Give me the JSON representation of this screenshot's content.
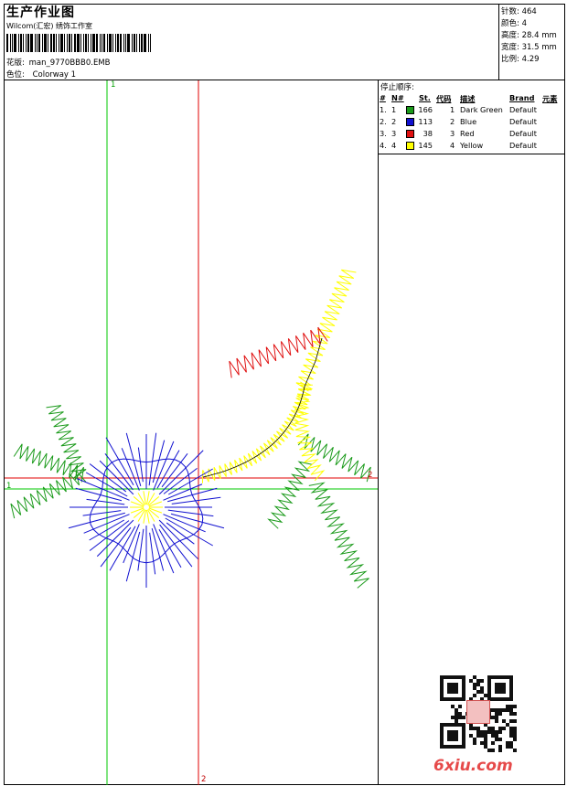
{
  "header": {
    "title": "生产作业图",
    "software": "Wilcom(汇宏) 绣饰工作室",
    "design_label": "花版:",
    "design_value": "man_9770BBB0.EMB",
    "colorway_label": "色位:",
    "colorway_value": "Colorway 1"
  },
  "stats": [
    {
      "label": "针数:",
      "value": "464"
    },
    {
      "label": "颜色:",
      "value": "4"
    },
    {
      "label": "高度:",
      "value": "28.4 mm"
    },
    {
      "label": "宽度:",
      "value": "31.5 mm"
    },
    {
      "label": "比例:",
      "value": "4.29"
    }
  ],
  "stop_sequence": {
    "title": "停止顺序:",
    "headers": [
      "#",
      "N#",
      "St.",
      "代码",
      "描述",
      "Brand",
      "元素"
    ],
    "rows": [
      {
        "idx": "1.",
        "n": "1",
        "color": "#1a9a1a",
        "stitches": "166",
        "code": "1",
        "desc": "Dark Green",
        "brand": "Default"
      },
      {
        "idx": "2.",
        "n": "2",
        "color": "#1010d0",
        "stitches": "113",
        "code": "2",
        "desc": "Blue",
        "brand": "Default"
      },
      {
        "idx": "3.",
        "n": "3",
        "color": "#e01010",
        "stitches": "38",
        "code": "3",
        "desc": "Red",
        "brand": "Default"
      },
      {
        "idx": "4.",
        "n": "4",
        "color": "#ffff00",
        "stitches": "145",
        "code": "4",
        "desc": "Yellow",
        "brand": "Default"
      }
    ]
  },
  "axes": {
    "marker_top": "1",
    "marker_left": "1",
    "marker_bottom": "2",
    "marker_right": "2"
  },
  "watermark": {
    "text": "6xiu.com"
  },
  "colors": {
    "green": "#1a9a1a",
    "blue": "#1010d0",
    "red": "#e01010",
    "yellow": "#ffff00"
  }
}
